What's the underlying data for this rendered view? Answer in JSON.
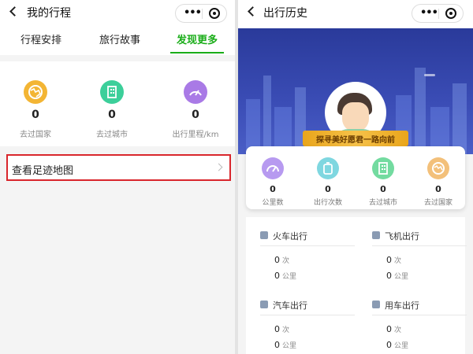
{
  "left": {
    "header": {
      "title": "我的行程"
    },
    "tabs": [
      {
        "label": "行程安排",
        "active": false
      },
      {
        "label": "旅行故事",
        "active": false
      },
      {
        "label": "发现更多",
        "active": true
      }
    ],
    "stats": [
      {
        "value": "0",
        "label": "去过国家",
        "icon": "globe-icon",
        "color": "#f3b534"
      },
      {
        "value": "0",
        "label": "去过城市",
        "icon": "city-building-icon",
        "color": "#3ccf9a"
      },
      {
        "value": "0",
        "label": "出行里程/km",
        "icon": "speedometer-icon",
        "color": "#a97ae6"
      }
    ],
    "footmap": {
      "label": "查看足迹地图"
    }
  },
  "right": {
    "header": {
      "title": "出行历史"
    },
    "ribbon": "探寻美好愿君一路向前",
    "stats": [
      {
        "value": "0",
        "label": "公里数",
        "icon": "speedometer-icon",
        "color": "#b79af0"
      },
      {
        "value": "0",
        "label": "出行次数",
        "icon": "suitcase-icon",
        "color": "#7fd7e0"
      },
      {
        "value": "0",
        "label": "去过城市",
        "icon": "city-building-icon",
        "color": "#73dba0"
      },
      {
        "value": "0",
        "label": "去过国家",
        "icon": "globe-icon",
        "color": "#f3c07a"
      }
    ],
    "modes": [
      {
        "title": "火车出行",
        "icon": "train-icon",
        "count": "0",
        "count_unit": "次",
        "distance": "0",
        "distance_unit": "公里"
      },
      {
        "title": "飞机出行",
        "icon": "airplane-icon",
        "count": "0",
        "count_unit": "次",
        "distance": "0",
        "distance_unit": "公里"
      },
      {
        "title": "汽车出行",
        "icon": "bus-icon",
        "count": "0",
        "count_unit": "次",
        "distance": "0",
        "distance_unit": "公里"
      },
      {
        "title": "用车出行",
        "icon": "car-icon",
        "count": "0",
        "count_unit": "次",
        "distance": "0",
        "distance_unit": "公里"
      }
    ]
  },
  "colors": {
    "accent": "#1aad19",
    "highlight_border": "#d9262c",
    "banner": "#3b4db6"
  }
}
